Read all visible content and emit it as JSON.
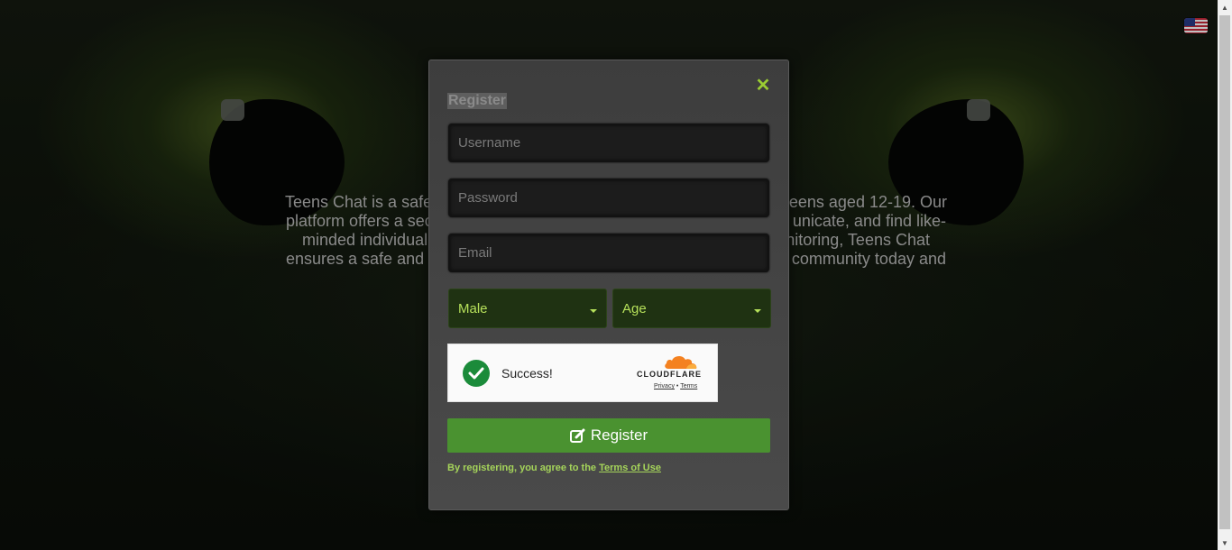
{
  "page": {
    "intro_lines": [
      "Teens Chat is a safe",
      "eens aged 12-19. Our",
      "platform offers a sec",
      "unicate, and find like-",
      "minded individual",
      "nitoring, Teens Chat",
      "ensures a safe and",
      "community today and"
    ]
  },
  "language": {
    "flag_icon": "us-flag-icon"
  },
  "modal": {
    "title": "Register",
    "close_icon": "close-icon",
    "username_placeholder": "Username",
    "password_placeholder": "Password",
    "email_placeholder": "Email",
    "gender_value": "Male",
    "age_value": "Age",
    "captcha": {
      "status": "Success!",
      "brand": "CLOUDFLARE",
      "privacy": "Privacy",
      "separator": "•",
      "terms": "Terms"
    },
    "register_button": "Register",
    "terms_prefix": "By registering, you agree to the",
    "terms_link": "Terms of Use"
  },
  "colors": {
    "accent_green": "#4a9230",
    "label_green": "#a5d45a",
    "close_green": "#9acd32",
    "select_bg": "#1f3212",
    "captcha_success": "#1b8b3a",
    "cloudflare_orange": "#f48120"
  }
}
